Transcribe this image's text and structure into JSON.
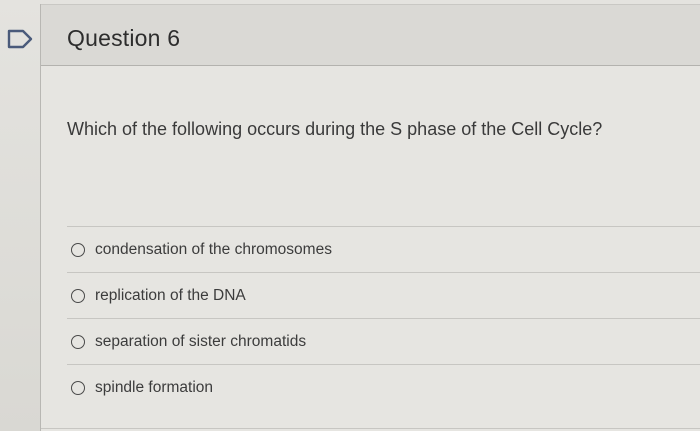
{
  "flag": {
    "icon": "flag-icon"
  },
  "question": {
    "title": "Question 6",
    "prompt": "Which of the following occurs during the S phase of the Cell Cycle?"
  },
  "options": [
    {
      "label": "condensation of the chromosomes"
    },
    {
      "label": "replication of the DNA"
    },
    {
      "label": "separation of sister chromatids"
    },
    {
      "label": "spindle formation"
    }
  ]
}
